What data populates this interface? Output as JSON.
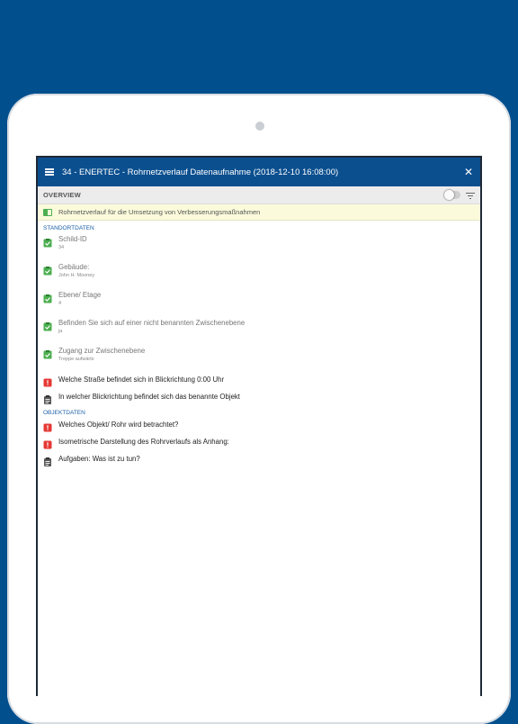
{
  "app": {
    "title": "34 - ENERTEC - Rohrnetzverlauf Datenaufnahme (2018-12-10 16:08:00)"
  },
  "overview": {
    "label": "OVERVIEW"
  },
  "banner": {
    "text": "Rohrnetzverlauf für die Umsetzung von Verbesserungsmaßnahmen"
  },
  "sections": [
    {
      "header": "STANDORTDATEN",
      "items": [
        {
          "label": "Schild-ID",
          "value": "34",
          "status": "done"
        },
        {
          "label": "Gebäude:",
          "value": "John H. Mooney",
          "status": "done"
        },
        {
          "label": "Ebene/ Etage",
          "value": "4",
          "status": "done"
        },
        {
          "label": "Befinden Sie sich auf einer nicht benannten Zwischenebene",
          "value": "ja",
          "status": "done"
        },
        {
          "label": "Zugang zur Zwischenebene",
          "value": "Treppe aufwärts",
          "status": "done"
        },
        {
          "label": "Welche Straße befindet sich in Blickrichtung 0:00 Uhr",
          "status": "error"
        },
        {
          "label": "In welcher Blickrichtung befindet sich das benannte Objekt",
          "status": "pending"
        }
      ]
    },
    {
      "header": "OBJEKTDATEN",
      "items": [
        {
          "label": "Welches Objekt/ Rohr wird betrachtet?",
          "status": "error"
        },
        {
          "label": "Isometrische Darstellung des Rohrverlaufs als Anhang:",
          "status": "error"
        },
        {
          "label": "Aufgaben: Was ist zu tun?",
          "status": "pending"
        }
      ]
    }
  ],
  "colors": {
    "background": "#024f8e",
    "appbar": "#0b4f8f",
    "done": "#4caf50",
    "error": "#e53935",
    "pending": "#555555",
    "section_header": "#1a5ea8"
  },
  "icons": {
    "done": "clipboard-check-icon",
    "error": "alert-icon",
    "pending": "clipboard-icon"
  }
}
